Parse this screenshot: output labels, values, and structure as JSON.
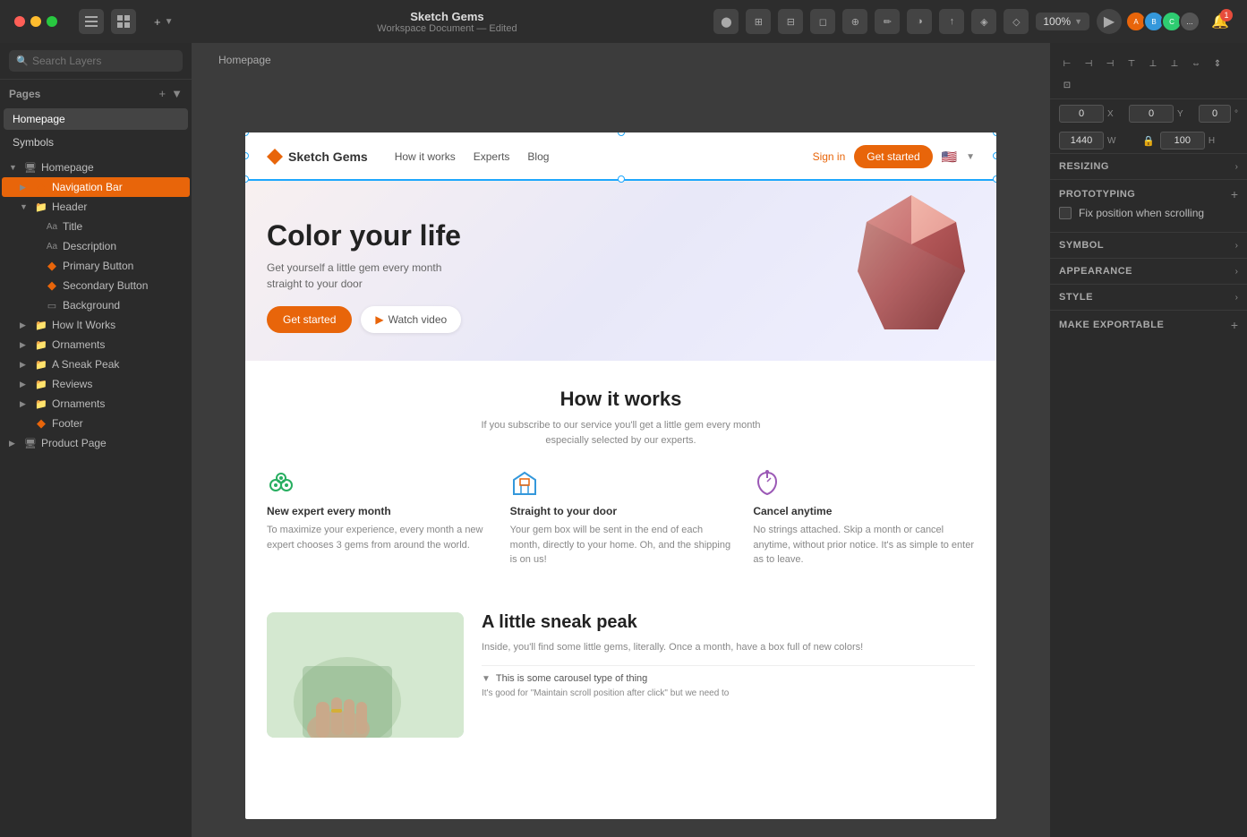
{
  "title_bar": {
    "app_name": "Sketch Gems",
    "doc_subtitle": "Workspace Document — Edited",
    "zoom": "100%",
    "notification_count": "1"
  },
  "left_panel": {
    "search_placeholder": "Search Layers",
    "pages_label": "Pages",
    "pages": [
      {
        "id": "homepage",
        "label": "Homepage",
        "active": true
      },
      {
        "id": "symbols",
        "label": "Symbols",
        "active": false
      }
    ],
    "layers": [
      {
        "id": "homepage-page",
        "label": "Homepage",
        "type": "page",
        "indent": 0,
        "expanded": true,
        "selected": false
      },
      {
        "id": "navigation-bar",
        "label": "Navigation Bar",
        "type": "symbol",
        "indent": 1,
        "expanded": false,
        "selected": true,
        "active": true
      },
      {
        "id": "header-group",
        "label": "Header",
        "type": "group",
        "indent": 1,
        "expanded": true,
        "selected": false
      },
      {
        "id": "title-text",
        "label": "Title",
        "type": "text",
        "indent": 2,
        "expanded": false,
        "selected": false
      },
      {
        "id": "description-text",
        "label": "Description",
        "type": "text",
        "indent": 2,
        "expanded": false,
        "selected": false
      },
      {
        "id": "primary-button",
        "label": "Primary Button",
        "type": "symbol",
        "indent": 2,
        "expanded": false,
        "selected": false
      },
      {
        "id": "secondary-button",
        "label": "Secondary Button",
        "type": "symbol",
        "indent": 2,
        "expanded": false,
        "selected": false
      },
      {
        "id": "background",
        "label": "Background",
        "type": "rect",
        "indent": 2,
        "expanded": false,
        "selected": false
      },
      {
        "id": "how-it-works",
        "label": "How It Works",
        "type": "group",
        "indent": 1,
        "expanded": false,
        "selected": false
      },
      {
        "id": "ornaments1",
        "label": "Ornaments",
        "type": "group",
        "indent": 1,
        "expanded": false,
        "selected": false
      },
      {
        "id": "sneak-peak",
        "label": "A Sneak Peak",
        "type": "group",
        "indent": 1,
        "expanded": false,
        "selected": false
      },
      {
        "id": "reviews",
        "label": "Reviews",
        "type": "group",
        "indent": 1,
        "expanded": false,
        "selected": false
      },
      {
        "id": "ornaments2",
        "label": "Ornaments",
        "type": "group",
        "indent": 1,
        "expanded": false,
        "selected": false
      },
      {
        "id": "footer",
        "label": "Footer",
        "type": "symbol",
        "indent": 1,
        "expanded": false,
        "selected": false
      },
      {
        "id": "product-page",
        "label": "Product Page",
        "type": "page",
        "indent": 0,
        "expanded": false,
        "selected": false
      }
    ]
  },
  "canvas": {
    "artboard_label": "Homepage"
  },
  "website": {
    "nav": {
      "logo_name": "Sketch Gems",
      "links": [
        "How it works",
        "Experts",
        "Blog"
      ],
      "signin": "Sign in",
      "getstarted": "Get started"
    },
    "hero": {
      "title": "Color your life",
      "desc_line1": "Get yourself a little gem every month",
      "desc_line2": "straight to your door",
      "btn_primary": "Get started",
      "btn_secondary": "Watch video"
    },
    "how_works": {
      "title": "How it works",
      "desc_line1": "If you subscribe to our service you'll get a little gem every month",
      "desc_line2": "especially selected by our experts.",
      "features": [
        {
          "title": "New expert every month",
          "desc": "To maximize your experience, every month a new expert chooses 3 gems from around the world."
        },
        {
          "title": "Straight to your door",
          "desc": "Your gem box will be sent in the end of each month, directly to your home. Oh, and the shipping is on us!"
        },
        {
          "title": "Cancel anytime",
          "desc": "No strings attached. Skip a month or cancel anytime, without prior notice. It's as simple to enter as to leave."
        }
      ]
    },
    "sneak_peek": {
      "title": "A little sneak peak",
      "desc": "Inside, you'll find some little gems, literally. Once a month, have a box full of new colors!",
      "carousel_title": "This is some carousel type of thing",
      "carousel_desc": "It's good for \"Maintain scroll position after click\" but we need to"
    }
  },
  "right_panel": {
    "coords": {
      "x_val": "0",
      "x_label": "X",
      "y_val": "0",
      "y_label": "Y",
      "deg_label": "°"
    },
    "size": {
      "w_val": "1440",
      "w_label": "W",
      "h_val": "100",
      "h_label": "H"
    },
    "sections": {
      "resizing": "RESIZING",
      "prototyping": "PROTOTYPING",
      "fix_position_label": "Fix position when scrolling",
      "symbol": "SYMBOL",
      "appearance": "APPEARANCE",
      "style": "STYLE",
      "make_exportable": "MAKE EXPORTABLE"
    }
  }
}
